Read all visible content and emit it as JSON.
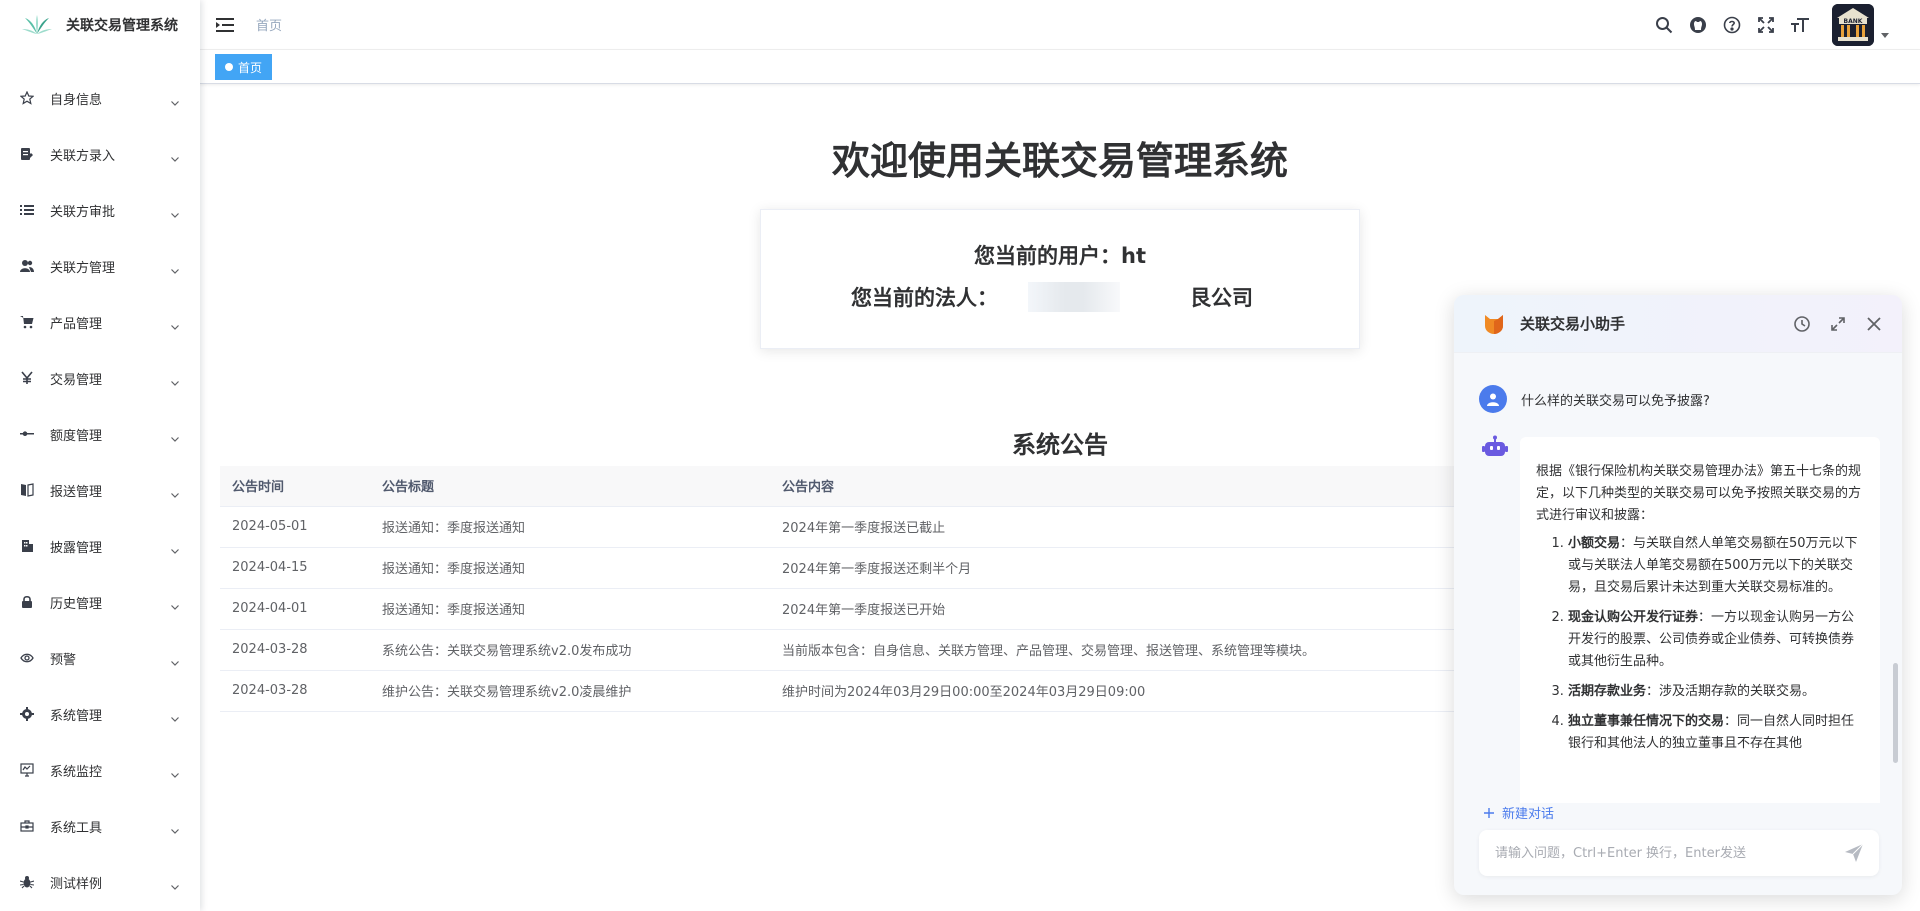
{
  "app": {
    "title": "关联交易管理系统"
  },
  "sidebar": {
    "items": [
      {
        "label": "自身信息",
        "icon": "star-icon"
      },
      {
        "label": "关联方录入",
        "icon": "edit-icon"
      },
      {
        "label": "关联方审批",
        "icon": "list-icon"
      },
      {
        "label": "关联方管理",
        "icon": "peoples-icon"
      },
      {
        "label": "产品管理",
        "icon": "cart-icon"
      },
      {
        "label": "交易管理",
        "icon": "yen-icon"
      },
      {
        "label": "额度管理",
        "icon": "slider-icon"
      },
      {
        "label": "报送管理",
        "icon": "book-icon"
      },
      {
        "label": "披露管理",
        "icon": "building-icon"
      },
      {
        "label": "历史管理",
        "icon": "lock-icon"
      },
      {
        "label": "预警",
        "icon": "eye-icon"
      },
      {
        "label": "系统管理",
        "icon": "gear-icon"
      },
      {
        "label": "系统监控",
        "icon": "monitor-icon"
      },
      {
        "label": "系统工具",
        "icon": "toolbox-icon"
      },
      {
        "label": "测试样例",
        "icon": "bug-icon"
      }
    ]
  },
  "header": {
    "breadcrumb": "首页",
    "avatar_text": "BANK"
  },
  "tags": {
    "active": "首页"
  },
  "main": {
    "welcome": "欢迎使用关联交易管理系统",
    "user_label": "您当前的用户：ht",
    "legal_label": "您当前的法人：",
    "legal_suffix": "艮公司",
    "notice_title": "系统公告",
    "columns": [
      "公告时间",
      "公告标题",
      "公告内容"
    ],
    "rows": [
      [
        "2024-05-01",
        "报送通知：季度报送通知",
        "2024年第一季度报送已截止"
      ],
      [
        "2024-04-15",
        "报送通知：季度报送通知",
        "2024年第一季度报送还剩半个月"
      ],
      [
        "2024-04-01",
        "报送通知：季度报送通知",
        "2024年第一季度报送已开始"
      ],
      [
        "2024-03-28",
        "系统公告：关联交易管理系统v2.0发布成功",
        "当前版本包含：自身信息、关联方管理、产品管理、交易管理、报送管理、系统管理等模块。"
      ],
      [
        "2024-03-28",
        "维护公告：关联交易管理系统v2.0凌晨维护",
        "维护时间为2024年03月29日00:00至2024年03月29日09:00"
      ]
    ]
  },
  "chat": {
    "title": "关联交易小助手",
    "question": "什么样的关联交易可以免予披露?",
    "answer_intro": "根据《银行保险机构关联交易管理办法》第五十七条的规定，以下几种类型的关联交易可以免予按照关联交易的方式进行审议和披露：",
    "answer_items": [
      {
        "bold": "小额交易",
        "text": "：与关联自然人单笔交易额在50万元以下或与关联法人单笔交易额在500万元以下的关联交易，且交易后累计未达到重大关联交易标准的。"
      },
      {
        "bold": "现金认购公开发行证券",
        "text": "：一方以现金认购另一方公开发行的股票、公司债券或企业债券、可转换债券或其他衍生品种。"
      },
      {
        "bold": "活期存款业务",
        "text": "：涉及活期存款的关联交易。"
      },
      {
        "bold": "独立董事兼任情况下的交易",
        "text": "：同一自然人同时担任银行和其他法人的独立董事且不存在其他"
      }
    ],
    "new_chat": "新建对话",
    "input_placeholder": "请输入问题，Ctrl+Enter 换行，Enter发送"
  }
}
